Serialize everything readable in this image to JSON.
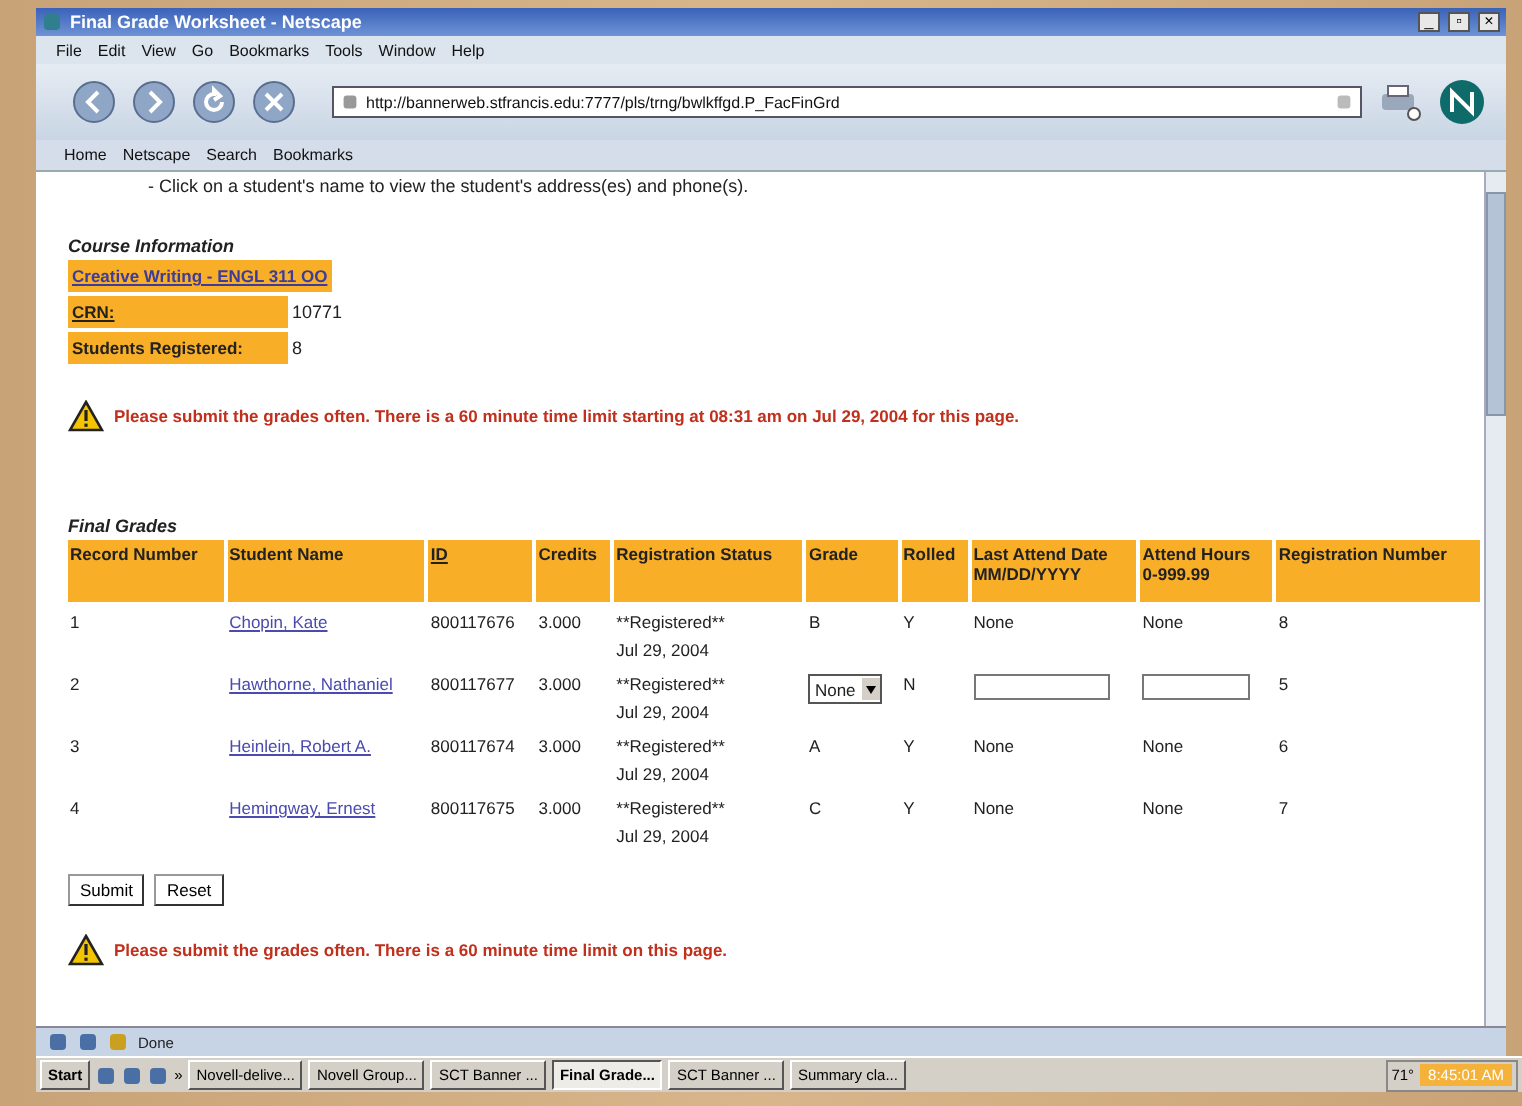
{
  "window": {
    "title": "Final Grade Worksheet - Netscape",
    "controls": [
      "_",
      "▫",
      "×"
    ]
  },
  "menu": [
    "File",
    "Edit",
    "View",
    "Go",
    "Bookmarks",
    "Tools",
    "Window",
    "Help"
  ],
  "address": {
    "value": "http://bannerweb.stfrancis.edu:7777/pls/trng/bwlkffgd.P_FacFinGrd"
  },
  "personal_toolbar": [
    "Home",
    "Netscape",
    "Search",
    "Bookmarks"
  ],
  "instructions": [
    "- Click on a student's name to view the student's address(es) and phone(s)."
  ],
  "course_info": {
    "heading": "Course Information",
    "course_link": "Creative Writing - ENGL 311 OO",
    "fields": [
      {
        "label": "CRN:",
        "value": "10771",
        "underlined": true
      },
      {
        "label": "Students Registered:",
        "value": "8",
        "underlined": false
      }
    ]
  },
  "warning_top": "Please submit the grades often. There is a 60 minute time limit starting at 08:31 am on Jul 29, 2004 for this page.",
  "final_grades": {
    "heading": "Final Grades",
    "columns": [
      {
        "label": "Record Number",
        "link": false
      },
      {
        "label": "Student Name",
        "link": false
      },
      {
        "label": "ID",
        "link": true
      },
      {
        "label": "Credits",
        "link": false
      },
      {
        "label": "Registration Status",
        "link": false
      },
      {
        "label": "Grade",
        "link": false
      },
      {
        "label": "Rolled",
        "link": false
      },
      {
        "label": "Last Attend Date",
        "sub": "MM/DD/YYYY",
        "link": false
      },
      {
        "label": "Attend Hours",
        "sub": "0-999.99",
        "link": false
      },
      {
        "label": "Registration Number",
        "link": false
      }
    ],
    "rows": [
      {
        "kind": "fixed",
        "record": "1",
        "name": "Chopin, Kate",
        "id": "800117676",
        "credits": "3.000",
        "status": "**Registered**",
        "date": "Jul 29, 2004",
        "grade": "B",
        "rolled": "Y",
        "last_attend": "None",
        "hours": "None",
        "reg_number": "8"
      },
      {
        "kind": "editable",
        "record": "2",
        "name": "Hawthorne, Nathaniel",
        "id": "800117677",
        "credits": "3.000",
        "status": "**Registered**",
        "date": "Jul 29, 2004",
        "grade": "None",
        "rolled": "N",
        "reg_number": "5"
      },
      {
        "kind": "fixed",
        "record": "3",
        "name": "Heinlein, Robert A.",
        "id": "800117674",
        "credits": "3.000",
        "status": "**Registered**",
        "date": "Jul 29, 2004",
        "grade": "A",
        "rolled": "Y",
        "last_attend": "None",
        "hours": "None",
        "reg_number": "6"
      },
      {
        "kind": "fixed",
        "record": "4",
        "name": "Hemingway, Ernest",
        "id": "800117675",
        "credits": "3.000",
        "status": "**Registered**",
        "date": "Jul 29, 2004",
        "grade": "C",
        "rolled": "Y",
        "last_attend": "None",
        "hours": "None",
        "reg_number": "7"
      }
    ]
  },
  "buttons": [
    "Submit",
    "Reset"
  ],
  "warning_bottom": "Please submit the grades often. There is a 60 minute time limit on this page.",
  "status_bar": {
    "text": "Done"
  },
  "taskbar": {
    "start": "Start",
    "more": "»",
    "tasks": [
      {
        "label": "Novell-delive...",
        "selected": false
      },
      {
        "label": "Novell Group...",
        "selected": false
      },
      {
        "label": "SCT Banner ...",
        "selected": false
      },
      {
        "label": "Final Grade...",
        "selected": true
      },
      {
        "label": "SCT Banner ...",
        "selected": false
      },
      {
        "label": "Summary cla...",
        "selected": false
      }
    ],
    "temperature": "71°",
    "clock": "8:45:01 AM"
  }
}
